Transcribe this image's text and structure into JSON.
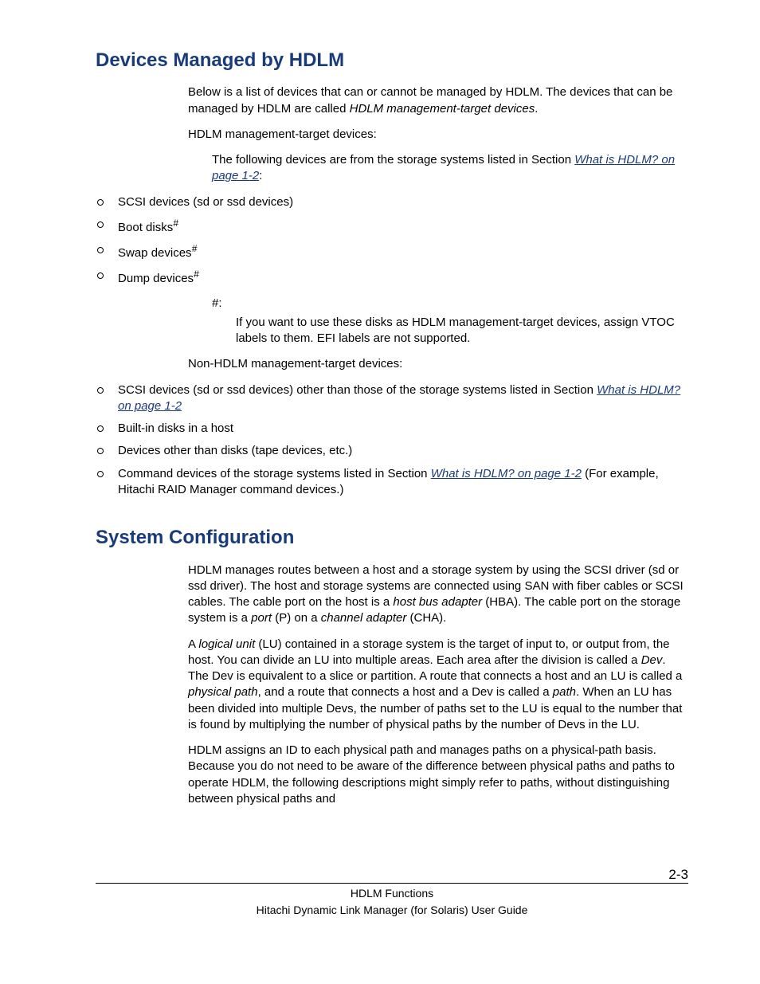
{
  "section1": {
    "heading": "Devices Managed by HDLM",
    "intro_a": "Below is a list of devices that can or cannot be managed by HDLM. The devices that can be managed by HDLM are called ",
    "intro_b": "HDLM management-target devices",
    "intro_c": ".",
    "mtd_label": "HDLM management-target devices:",
    "mtd_lead_a": "The following devices are from the storage systems listed in Section ",
    "mtd_link": "What is HDLM? on page 1-2",
    "mtd_lead_b": ":",
    "bullets1": {
      "b1": "SCSI devices (sd or ssd devices)",
      "b2": "Boot disks",
      "b3": "Swap devices",
      "b4": "Dump devices",
      "hash": "#"
    },
    "hash_label": "#:",
    "hash_text": "If you want to use these disks as HDLM management-target devices, assign VTOC labels to them. EFI labels are not supported.",
    "non_label": "Non-HDLM management-target devices:",
    "bullets2": {
      "b1a": "SCSI devices (sd or ssd devices) other than those of the storage systems listed in Section ",
      "b1link": "What is HDLM? on page 1-2",
      "b2": "Built-in disks in a host",
      "b3": "Devices other than disks (tape devices, etc.)",
      "b4a": "Command devices of the storage systems listed in Section ",
      "b4link": "What is HDLM? on page 1-2",
      "b4b": " (For example, Hitachi RAID Manager command devices.)"
    }
  },
  "section2": {
    "heading": "System Configuration",
    "p1a": "HDLM manages routes between a host and a storage system by using the SCSI driver (sd or ssd driver). The host and storage systems are connected using SAN with fiber cables or SCSI cables. The cable port on the host is a ",
    "p1b": "host bus adapter",
    "p1c": " (HBA). The cable port on the storage system is a ",
    "p1d": "port",
    "p1e": " (P) on a ",
    "p1f": "channel adapter",
    "p1g": " (CHA).",
    "p2a": "A ",
    "p2b": "logical unit",
    "p2c": " (LU) contained in a storage system is the target of input to, or output from, the host. You can divide an LU into multiple areas. Each area after the division is called a ",
    "p2d": "Dev",
    "p2e": ". The Dev is equivalent to a slice or partition. A route that connects a host and an LU is called a ",
    "p2f": "physical path",
    "p2g": ", and a route that connects a host and a Dev is called a ",
    "p2h": "path",
    "p2i": ". When an LU has been divided into multiple Devs, the number of paths set to the LU is equal to the number that is found by multiplying the number of physical paths by the number of Devs in the LU.",
    "p3": "HDLM assigns an ID to each physical path and manages paths on a physical-path basis. Because you do not need to be aware of the difference between physical paths and paths to operate HDLM, the following descriptions might simply refer to paths, without distinguishing between physical paths and"
  },
  "footer": {
    "line1": "HDLM Functions",
    "line2": "Hitachi Dynamic Link Manager (for Solaris) User Guide",
    "pagenum": "2-3"
  }
}
